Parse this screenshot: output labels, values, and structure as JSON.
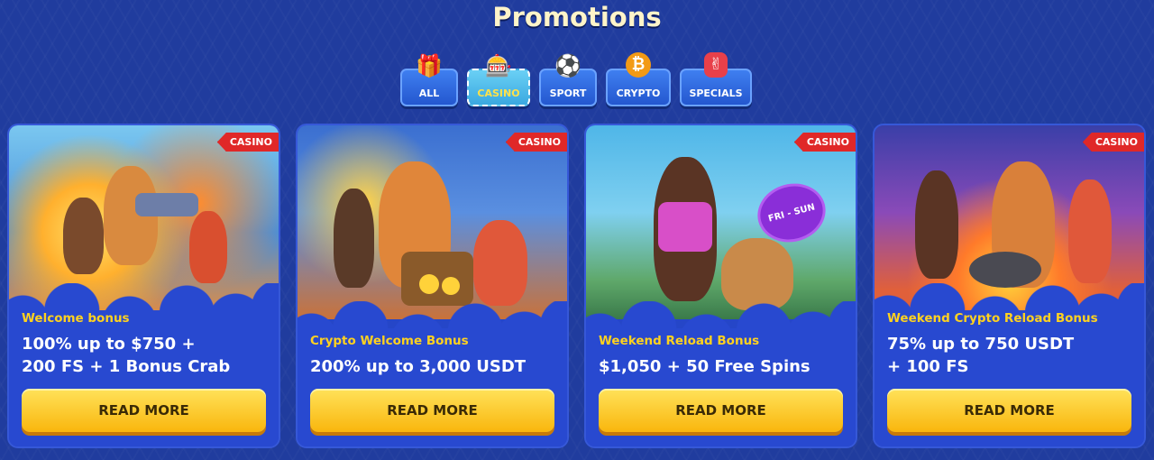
{
  "page": {
    "title": "Promotions"
  },
  "filters": [
    {
      "label": "ALL",
      "icon": "gift-icon",
      "glyph": "🎁",
      "active": false
    },
    {
      "label": "CASINO",
      "icon": "slot-machine-icon",
      "glyph": "🎰",
      "active": true
    },
    {
      "label": "SPORT",
      "icon": "soccer-ball-icon",
      "glyph": "⚽",
      "active": false
    },
    {
      "label": "CRYPTO",
      "icon": "bitcoin-icon",
      "glyph": "₿",
      "active": false
    },
    {
      "label": "SPECIALS",
      "icon": "hand-icon",
      "glyph": "✌",
      "active": false
    }
  ],
  "cards": [
    {
      "badge": "CASINO",
      "subtitle": "Welcome bonus",
      "offer": "100% up to $750 +\n200 FS + 1 Bonus Crab",
      "button": "READ MORE"
    },
    {
      "badge": "CASINO",
      "subtitle": "Crypto Welcome Bonus",
      "offer": "200% up to 3,000 USDT",
      "button": "READ MORE"
    },
    {
      "badge": "CASINO",
      "subtitle": "Weekend Reload Bonus",
      "offer": "$1,050 + 50 Free Spins",
      "button": "READ MORE"
    },
    {
      "badge": "CASINO",
      "subtitle": "Weekend Crypto Reload Bonus",
      "offer": "75% up to 750 USDT\n+ 100 FS",
      "button": "READ MORE"
    }
  ],
  "art_labels": {
    "card3_disc": "FRI - SUN"
  },
  "colors": {
    "accent": "#ffd21f",
    "badge": "#e02828",
    "background": "#203c9e",
    "button": "#f9c21a"
  }
}
